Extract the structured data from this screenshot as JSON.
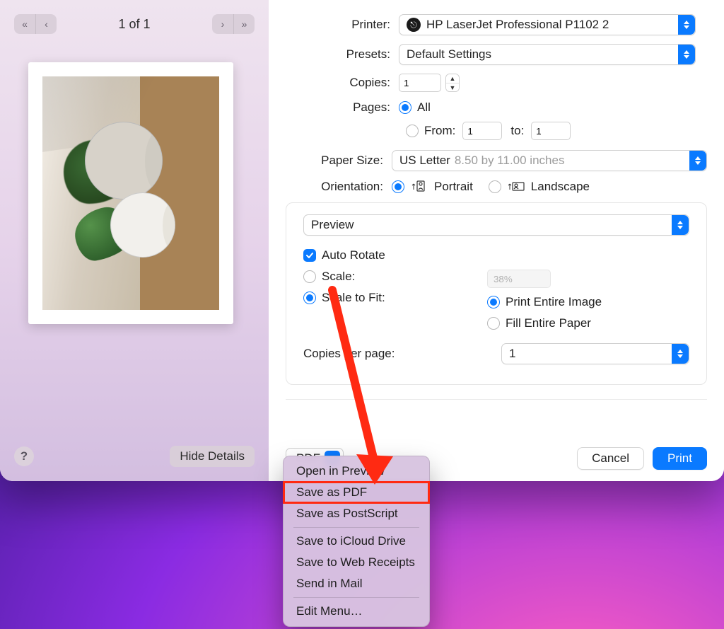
{
  "nav": {
    "page_indicator": "1 of 1"
  },
  "left_footer": {
    "help": "?",
    "hide_details": "Hide Details"
  },
  "labels": {
    "printer": "Printer:",
    "presets": "Presets:",
    "copies": "Copies:",
    "pages": "Pages:",
    "from": "From:",
    "to": "to:",
    "paper_size": "Paper Size:",
    "orientation": "Orientation:"
  },
  "printer": {
    "name": "HP LaserJet Professional P1102 2"
  },
  "presets": {
    "value": "Default Settings"
  },
  "copies": {
    "value": "1"
  },
  "pages": {
    "all": "All",
    "from": "1",
    "to": "1"
  },
  "paper_size": {
    "value": "US Letter",
    "note": "8.50 by 11.00 inches"
  },
  "orientation": {
    "portrait": "Portrait",
    "landscape": "Landscape"
  },
  "options": {
    "tab": "Preview",
    "auto_rotate": "Auto Rotate",
    "scale": "Scale:",
    "scale_value": "38%",
    "scale_to_fit": "Scale to Fit:",
    "print_entire_image": "Print Entire Image",
    "fill_entire_paper": "Fill Entire Paper",
    "copies_per_page": "Copies per page:",
    "copies_per_page_value": "1"
  },
  "footer": {
    "pdf": "PDF",
    "cancel": "Cancel",
    "print": "Print"
  },
  "menu": {
    "items": [
      "Open in Preview",
      "Save as PDF",
      "Save as PostScript",
      "Save to iCloud Drive",
      "Save to Web Receipts",
      "Send in Mail",
      "Edit Menu…"
    ]
  }
}
